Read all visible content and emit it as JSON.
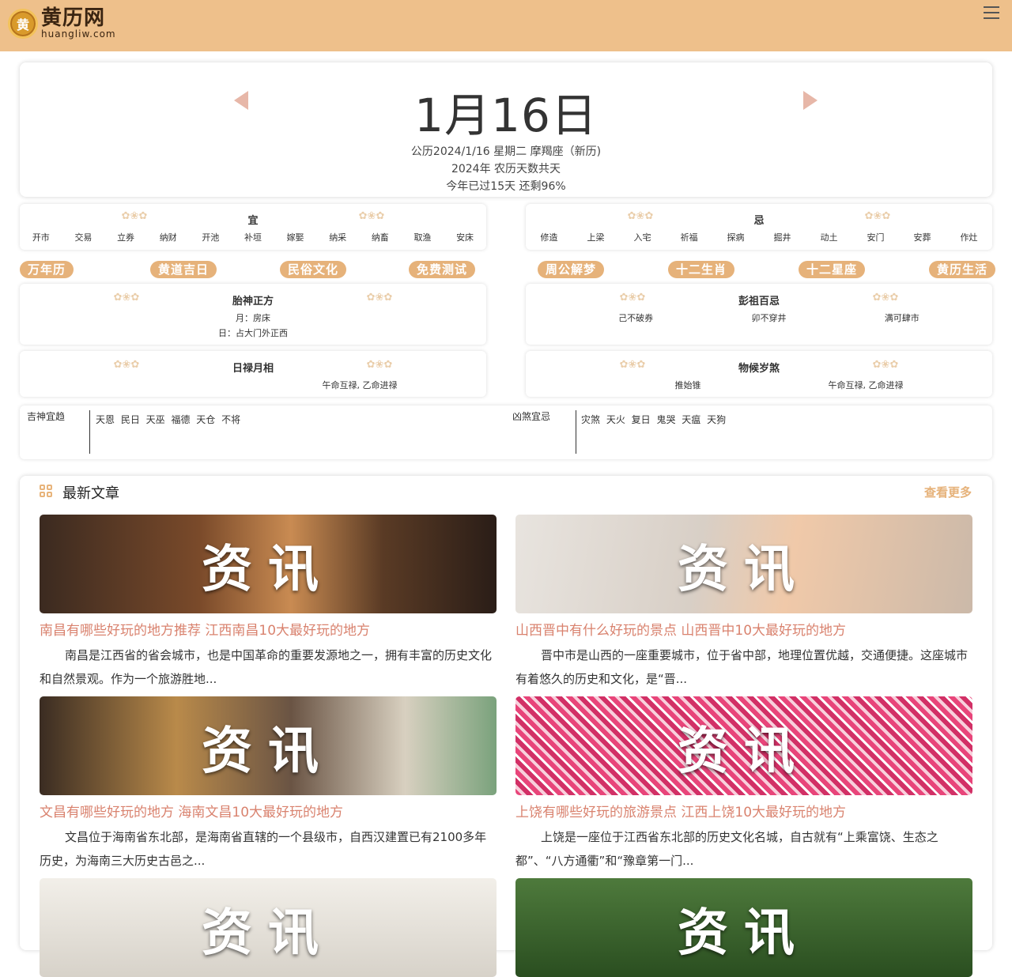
{
  "header": {
    "logo_mark": "黄",
    "logo_title": "黄历网",
    "logo_sub": "huangliw.com"
  },
  "date": {
    "big": "1月16日",
    "line1": "公历2024/1/16 星期二 摩羯座（新历)",
    "line2": "2024年 农历天数共天",
    "line3": "今年已过15天 还剩96%"
  },
  "yi": {
    "title": "宜",
    "items": [
      "开市",
      "交易",
      "立券",
      "纳财",
      "开池",
      "补垣",
      "嫁娶",
      "纳采",
      "纳畜",
      "取渔",
      "安床"
    ]
  },
  "ji": {
    "title": "忌",
    "items": [
      "修造",
      "上梁",
      "入宅",
      "祈福",
      "探病",
      "掘井",
      "动土",
      "安门",
      "安葬",
      "作灶"
    ]
  },
  "tags_left": [
    "万年历",
    "黄道吉日",
    "民俗文化",
    "免费测试"
  ],
  "tags_right": [
    "周公解梦",
    "十二生肖",
    "十二星座",
    "黄历生活"
  ],
  "taishen": {
    "title": "胎神正方",
    "month": "月：房床",
    "day": "日：占大门外正西"
  },
  "pengzu": {
    "title": "彭祖百忌",
    "items": [
      "己不破券",
      "卯不穿井",
      "满可肆市"
    ]
  },
  "rilu": {
    "title": "日禄月相",
    "value": "午命互禄, 乙命进禄"
  },
  "wuhou": {
    "title": "物候岁煞",
    "left": "推始锥",
    "right": "午命互禄, 乙命进禄"
  },
  "jishen": {
    "label": "吉神宜趋",
    "values": "天恩 民日 天巫 福德 天仓 不将"
  },
  "xiongsha": {
    "label": "凶煞宜忌",
    "values": "灾煞 天火 复日 鬼哭 天瘟 天狗"
  },
  "articles": {
    "heading": "最新文章",
    "more": "查看更多",
    "stamp": "资讯",
    "items": [
      {
        "title": "南昌有哪些好玩的地方推荐 江西南昌10大最好玩的地方",
        "desc": "南昌是江西省的省会城市，也是中国革命的重要发源地之一，拥有丰富的历史文化和自然景观。作为一个旅游胜地...",
        "bg": "linear-gradient(90deg,#3b2a20 0%,#7a4a2a 35%,#c98b52 55%,#5a3b25 75%,#2a1d17 100%)"
      },
      {
        "title": "山西晋中有什么好玩的景点 山西晋中10大最好玩的地方",
        "desc": "晋中市是山西的一座重要城市，位于省中部，地理位置优越，交通便捷。这座城市有着悠久的历史和文化，是“晋...",
        "bg": "linear-gradient(100deg,#e8e4df 0%,#d8cfc6 40%,#f0c9a9 60%,#cbb9a9 100%)"
      },
      {
        "title": "文昌有哪些好玩的地方 海南文昌10大最好玩的地方",
        "desc": "文昌位于海南省东北部，是海南省直辖的一个县级市，自西汉建置已有2100多年历史，为海南三大历史古邑之...",
        "bg": "linear-gradient(90deg,#3a2c22 0%,#b98a4a 30%,#6a5444 55%,#d8d0c0 80%,#7aa27c 100%)"
      },
      {
        "title": "上饶有哪些好玩的旅游景点 江西上饶10大最好玩的地方",
        "desc": "上饶是一座位于江西省东北部的历史文化名城，自古就有“上乘富饶、生态之都”、“八方通衢”和“豫章第一门...",
        "bg": "repeating-linear-gradient(45deg,#e8457a 0 6px,#f8d0dc 6px 10px,#d23066 10px 16px,#ffffff 16px 19px)"
      }
    ],
    "bottom_bgs": [
      "linear-gradient(180deg,#f2efe9,#d7d2c9)",
      "linear-gradient(180deg,#4e7a3c,#2a4e20)"
    ]
  }
}
